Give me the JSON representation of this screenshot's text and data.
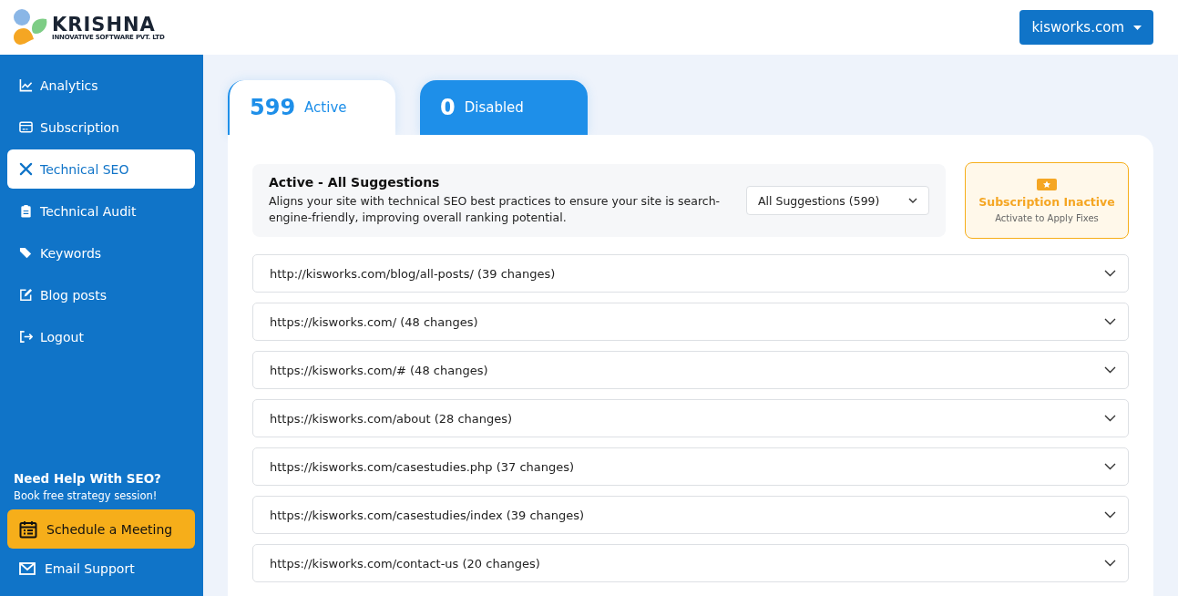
{
  "logo": {
    "name": "KRISHNA",
    "tagline": "INNOVATIVE SOFTWARE PVT. LTD"
  },
  "site_select": {
    "value": "kisworks.com"
  },
  "sidebar": {
    "items": [
      {
        "label": "Analytics",
        "selected": false
      },
      {
        "label": "Subscription",
        "selected": false
      },
      {
        "label": "Technical SEO",
        "selected": true
      },
      {
        "label": "Technical Audit",
        "selected": false
      },
      {
        "label": "Keywords",
        "selected": false
      },
      {
        "label": "Blog posts",
        "selected": false
      },
      {
        "label": "Logout",
        "selected": false
      }
    ],
    "help": {
      "title": "Need Help With SEO?",
      "subtitle": "Book free strategy session!"
    },
    "meeting_button": "Schedule a Meeting",
    "email_link": "Email Support"
  },
  "tabs": [
    {
      "count": "599",
      "label": "Active",
      "selected": true
    },
    {
      "count": "0",
      "label": "Disabled",
      "selected": false
    }
  ],
  "summary": {
    "title": "Active - All Suggestions",
    "description": "Aligns your site with technical SEO best practices to ensure your site is search-engine-friendly, improving overall ranking potential.",
    "filter": "All Suggestions (599)"
  },
  "subscription": {
    "title": "Subscription Inactive",
    "subtitle": "Activate to Apply Fixes"
  },
  "pages": [
    {
      "label": "http://kisworks.com/blog/all-posts/ (39 changes)",
      "expanded": false
    },
    {
      "label": "https://kisworks.com/ (48 changes)",
      "expanded": false
    },
    {
      "label": "https://kisworks.com/# (48 changes)",
      "expanded": false
    },
    {
      "label": "https://kisworks.com/about (28 changes)",
      "expanded": false
    },
    {
      "label": "https://kisworks.com/casestudies.php (37 changes)",
      "expanded": false
    },
    {
      "label": "https://kisworks.com/casestudies/index (39 changes)",
      "expanded": false
    },
    {
      "label": "https://kisworks.com/contact-us (20 changes)",
      "expanded": false
    }
  ]
}
